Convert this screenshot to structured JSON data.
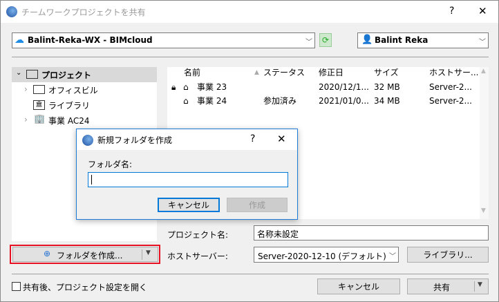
{
  "window": {
    "title": "チームワークプロジェクトを共有",
    "help": "?",
    "close": "✕"
  },
  "server": {
    "value": "Balint-Reka-WX - BIMcloud"
  },
  "user": {
    "value": "Balint Reka"
  },
  "tree": {
    "items": [
      {
        "label": "プロジェクト"
      },
      {
        "label": "オフィスビル"
      },
      {
        "label": "ライブラリ"
      },
      {
        "label": "事業 AC24"
      }
    ]
  },
  "list": {
    "columns": [
      "名前",
      "ステータス",
      "修正日",
      "サイズ",
      "ホストサー..."
    ],
    "rows": [
      {
        "name": "事業 23",
        "status": "",
        "date": "2020/12/1...",
        "size": "32 MB",
        "host": "Server-2..."
      },
      {
        "name": "事業 24",
        "status": "参加済み",
        "date": "2021/01/0...",
        "size": "34 MB",
        "host": "Server-2..."
      }
    ]
  },
  "form": {
    "project_name_label": "プロジェクト名:",
    "project_name_value": "名称未設定",
    "host_label": "ホストサーバー:",
    "host_value": "Server-2020-12-10 (デフォルト)",
    "library_button": "ライブラリ..."
  },
  "create_folder_button": "フォルダを作成...",
  "footer": {
    "checkbox_label": "共有後、プロジェクト設定を開く",
    "cancel": "キャンセル",
    "share": "共有"
  },
  "dialog": {
    "title": "新規フォルダを作成",
    "help": "?",
    "close": "✕",
    "field_label": "フォルダ名:",
    "field_value": "",
    "cancel": "キャンセル",
    "create": "作成"
  },
  "colors": {
    "accent": "#0078d7",
    "highlight": "#e81123"
  }
}
